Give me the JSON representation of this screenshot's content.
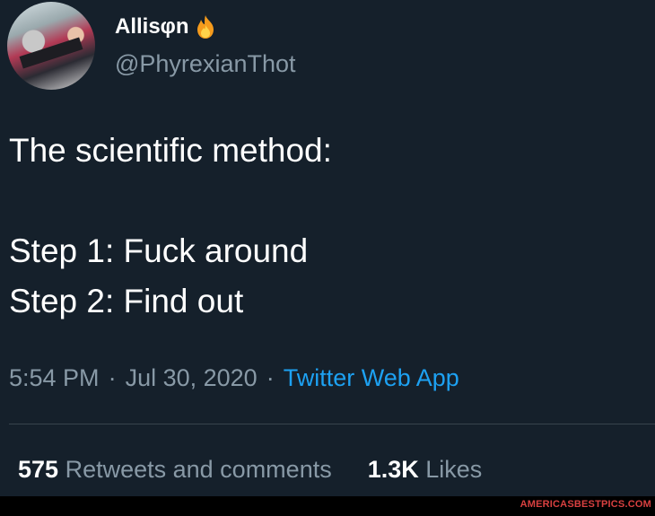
{
  "tweet": {
    "display_name": "Allisφn",
    "handle": "@PhyrexianThot",
    "name_emoji": "fire-icon",
    "text_line1": "The scientific method:",
    "text_line2": "Step 1: Fuck around",
    "text_line3": "Step 2: Find out",
    "time": "5:54 PM",
    "date": "Jul 30, 2020",
    "separator": "·",
    "app": "Twitter Web App"
  },
  "stats": {
    "retweets_count": "575",
    "retweets_label": "Retweets and comments",
    "likes_count": "1.3K",
    "likes_label": "Likes"
  },
  "watermark": "AMERICASBESTPICS.COM",
  "colors": {
    "background": "#15202b",
    "text": "#ffffff",
    "secondary": "#8899a6",
    "link": "#1da1f2",
    "divider": "#38444d",
    "watermark": "#d84040"
  }
}
